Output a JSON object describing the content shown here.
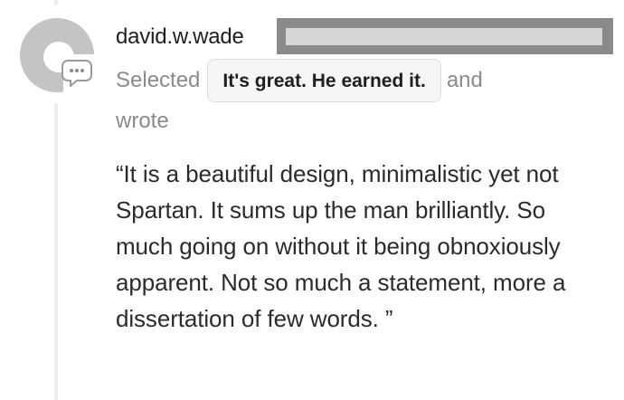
{
  "comment": {
    "username": "david.w.wade",
    "action_prefix": "Selected",
    "selected_choice": "It's great. He earned it.",
    "action_suffix": "and",
    "action_continuation": "wrote",
    "body": "“It is a beautiful design, minimalistic yet not Spartan. It sums up the man brilliantly. So much going on without it being obnoxiously apparent. Not so much a statement, more a dissertation of few words. ”"
  },
  "icons": {
    "avatar": "default-avatar-icon",
    "badge": "comment-bubble-icon"
  },
  "colors": {
    "text_primary": "#1f1f22",
    "text_muted": "#8a8a8f",
    "avatar_gray": "#c4c4c4",
    "redaction": "#8a8a8a",
    "chip_background": "#f6f6f7",
    "chip_border": "#dedee2"
  }
}
